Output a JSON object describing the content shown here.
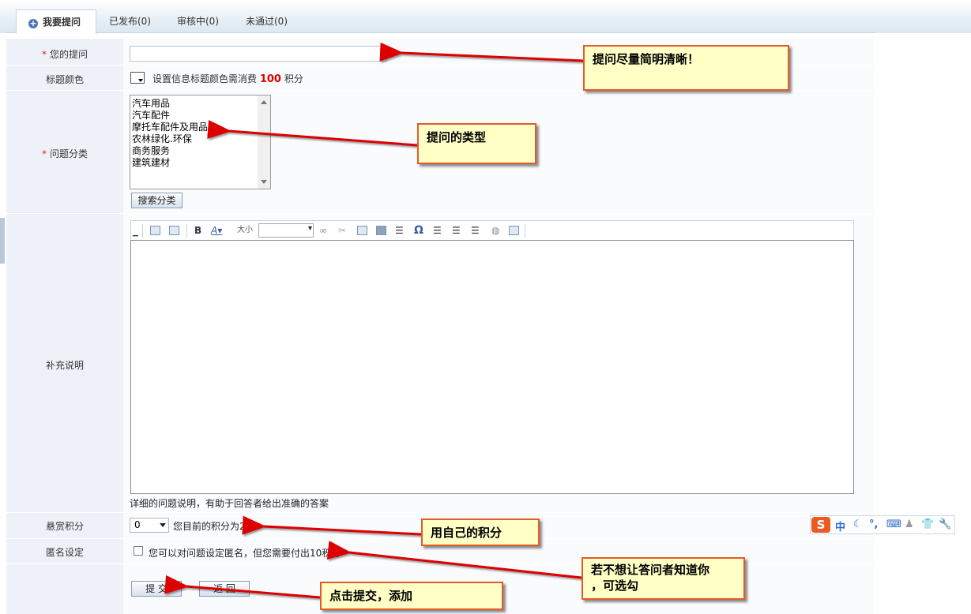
{
  "tabs": [
    {
      "label": "我要提问",
      "active": true
    },
    {
      "label": "已发布(0)",
      "active": false
    },
    {
      "label": "审核中(0)",
      "active": false
    },
    {
      "label": "未通过(0)",
      "active": false
    }
  ],
  "form": {
    "required_mark": "*",
    "question_label": "您的提问",
    "question_value": "",
    "title_color_label": "标题颜色",
    "title_color_text_pre": "设置信息标题颜色需消费",
    "title_color_points": "100",
    "title_color_text_post": "积分",
    "category_label": "问题分类",
    "categories": [
      "汽车用品",
      "汽车配件",
      "摩托车配件及用品",
      "农林绿化.环保",
      "商务服务",
      "建筑建材"
    ],
    "search_category_button": "搜索分类",
    "supplement_label": "补充说明",
    "editor_font_size_label": "大小",
    "editor_hint": "详细的问题说明，有助于回答者给出准确的答案",
    "reward_label": "悬赏积分",
    "reward_value": "0",
    "reward_text": "您目前的积分为204",
    "anonymous_label": "匿名设定",
    "anonymous_text": "您可以对问题设定匿名，但您需要付出10积分",
    "anonymous_checked": false,
    "submit_button": "提 交",
    "back_button": "返 回"
  },
  "annotations": {
    "question_tip": "提问尽量简明清晰！",
    "category_tip": "提问的类型",
    "reward_tip": "用自己的积分",
    "anonymous_tip_line1": "若不想让答问者知道你",
    "anonymous_tip_line2": "，可选勾",
    "submit_tip": "点击提交，添加"
  },
  "ime": {
    "logo": "S",
    "mode": "中"
  },
  "colors": {
    "label_bg": "#eef2f8",
    "points_red": "#e00000",
    "callout_bg": "#ffffc6",
    "arrow_red": "#dd0000"
  }
}
